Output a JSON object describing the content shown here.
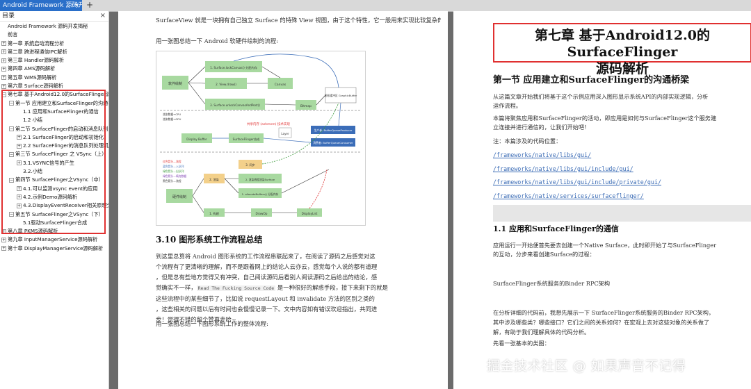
{
  "tab": {
    "title": "Android Framework 源码开发",
    "close": "×",
    "add": "+"
  },
  "sidebar": {
    "header": "目录",
    "close": "×",
    "items": [
      {
        "label": "Android Framework 源码开发揭秘",
        "level": 0,
        "expander": ""
      },
      {
        "label": "前言",
        "level": 0,
        "expander": ""
      },
      {
        "label": "第一章 系统启动流程分析",
        "level": 0,
        "expander": "+"
      },
      {
        "label": "第二章 跨进程通信IPC解析",
        "level": 0,
        "expander": "+"
      },
      {
        "label": "第三章 Handler源码解析",
        "level": 0,
        "expander": "+"
      },
      {
        "label": "第四章 AMS源码解析",
        "level": 0,
        "expander": "+"
      },
      {
        "label": "第五章 WMS源码解析",
        "level": 0,
        "expander": "+"
      },
      {
        "label": "第六章 Surface源码解析",
        "level": 0,
        "expander": "+"
      },
      {
        "label": "第七章 基于Android12.0的SurfaceFlinger源码解析",
        "level": 0,
        "expander": "−"
      },
      {
        "label": "第一节 应用建立和SurfaceFlinger的沟通桥梁",
        "level": 1,
        "expander": "−"
      },
      {
        "label": "1.1 应用和SurfaceFlinger的通信",
        "level": 2,
        "expander": ""
      },
      {
        "label": "1.2 小结",
        "level": 2,
        "expander": ""
      },
      {
        "label": "第二节 SurfaceFlinger的启动和消息队列处理机制",
        "level": 1,
        "expander": "−"
      },
      {
        "label": "2.1 SurfaceFlinger的启动和初始化",
        "level": 2,
        "expander": "+"
      },
      {
        "label": "2.2 SurfaceFlinger的消息队列处理机制",
        "level": 2,
        "expander": "+"
      },
      {
        "label": "第三节 SurfaceFlinger 之 VSync（上）",
        "level": 1,
        "expander": "−"
      },
      {
        "label": "3.1.VSYNC信号的产生",
        "level": 2,
        "expander": "+"
      },
      {
        "label": "3.2.小结",
        "level": 2,
        "expander": ""
      },
      {
        "label": "第四节 SurfaceFlinger之VSync（中）",
        "level": 1,
        "expander": "−"
      },
      {
        "label": "4.1.可以监测vsync event的应用",
        "level": 2,
        "expander": "+"
      },
      {
        "label": "4.2.示例Demo源码解析",
        "level": 2,
        "expander": "+"
      },
      {
        "label": "4.3.DisplayEventReceiver相关原理分析",
        "level": 2,
        "expander": "+"
      },
      {
        "label": "第五节 SurfaceFlinger之VSync（下）",
        "level": 1,
        "expander": "−"
      },
      {
        "label": "5.1驱动SurfaceFlinger合成",
        "level": 2,
        "expander": ""
      },
      {
        "label": "第八章 PKMS源码解析",
        "level": 0,
        "expander": "+"
      },
      {
        "label": "第九章 InputManagerService源码解析",
        "level": 0,
        "expander": "+"
      },
      {
        "label": "第十章 DisplayManagerService源码解析",
        "level": 0,
        "expander": "+"
      }
    ]
  },
  "left_page": {
    "intro": "SurfaceView 就是一块拥有自己独立 Surface 的特殊 View 视图，由于这个特性，它一般用来实现比较复杂的图像或动画/视频的显示。",
    "intro_line2": "一般用来实现比较复杂的图像或动画/视频的显示。",
    "draw_flow_caption": "用一张图总结一下 Android 软硬件绘制的流程:",
    "diagram": {
      "software_draw": "软件绘制",
      "step1": "1. Surface.lockCanvas() 分配内存",
      "step2": "2. View.draw()",
      "step3": "3. Surface.unlockCanvasAndPost()",
      "canvas": "Canvas",
      "bitmap": "Bitmap",
      "graphic_buffer": "图形缓冲区 GraphicBuffer",
      "legend_cpu1": "渲染数据→CPU",
      "legend_gpu1": "渲染数据→GPU",
      "note_red": "共享内存 (ashmem) 技术实现",
      "producer": "生产者: BufferQueueProducer",
      "consumer": "消费者: BufferQueueConsumer",
      "layer": "Layer",
      "display_buffer": "Display Buffer",
      "surfaceflinger": "SurfaceFlinger合成",
      "legend_red": "红色箭头—流程",
      "legend_blue": "蓝色箭头—入队列",
      "legend_green": "绿色箭头—出队列",
      "legend_green2": "绿色箭头—填充数据",
      "legend_black": "黑色箭头—流程",
      "hw_draw": "硬件绘制",
      "sync": "3. 同步",
      "render": "2. 渲染",
      "draw_gl": "2. 渲染线程渲染Surface",
      "alloc": "1. allocateBuffers() 分配内存",
      "build": "1. 构建",
      "drawop": "DrawOp",
      "displaylist": "DisplayList"
    },
    "section_title": "3.10 图形系统工作流程总结",
    "para_lines": [
      "到这里总算将 Android 图形系统的工作流程串联起来了，在阅读了源码之后感觉对这",
      "个流程有了更清晰的理解，而不是跟着网上的结论人云亦云，感觉每个人说的都有道理",
      "，但是总有些地方觉得又有冲突，自己阅读源码后看别人阅读源码之后给出的结论，感",
      "觉确实不一样，",
      "是一种很好的解惑手段，接下来剩下的就是",
      "这些流程中的某些细节了，比如说 requestLayout 和 invalidate 方法的区别之类的",
      "，这些相关的问题以后有时间也会慢慢记录一下。文中内容如有错误欢迎指出，共同进",
      "步！觉得不错的留个赞再走哈~"
    ],
    "rtfsc": "Read The Fucking Source Code",
    "overall_caption": "用一张图总结一下图形系统工作的整体流程:"
  },
  "right_page": {
    "chapter_title_line1": "第七章 基于Android12.0的SurfaceFlinger",
    "chapter_title_line2": "源码解析",
    "section1_title": "第一节 应用建立和SurfaceFlinger的沟通桥梁",
    "p1_l1": "从这篇文章开始我们将基于这个示例应用深入图形显示系统API的内部实现逻辑，分析",
    "p1_l2": "运作流程。",
    "p2_l1": "本篇将聚焦应用和SurfaceFlinger的活动，即应用是如何与SurfaceFlinger这个服务建",
    "p2_l2": "立连接并进行通信的，让我们开始吧！",
    "note": "注：本篇涉及的代码位置：",
    "links": [
      "/frameworks/native/libs/gui/",
      "/frameworks/native/libs/gui/include/gui/",
      "/frameworks/native/libs/gui/include/private/gui/",
      "/frameworks/native/services/surfaceflinger/"
    ],
    "sub_title": "1.1 应用和SurfaceFlinger的通信",
    "p3_l1": "应用运行一开始便首先要去创建一个Native Surface，此时即开始了与SurfaceFlinger",
    "p3_l2": "的互动，分步来看创建Surface的过程：",
    "binder": "SurfaceFlinger系统服务的Binder RPC架构",
    "p4_l1": "在分析详细的代码前，我想先展示一下 SurfaceFlinger系统服务的Binder RPC架构，",
    "p4_l2": "其中涉及哪些类？哪些接口？它们之间的关系如何？在宏观上去对这些对象的关系做了",
    "p4_l3": "解，有助于我们理解具体的代码分析。",
    "p5": "先看一张基本的类图："
  },
  "watermark": "掘金技术社区 @ 如果声音不记得",
  "colors": {
    "tab_active": "#2a6fc9",
    "highlight_red": "#e03030",
    "link": "#3a6bb5",
    "diagram_green": "#a8d9a0",
    "diagram_box_blue": "#3b6db8"
  }
}
